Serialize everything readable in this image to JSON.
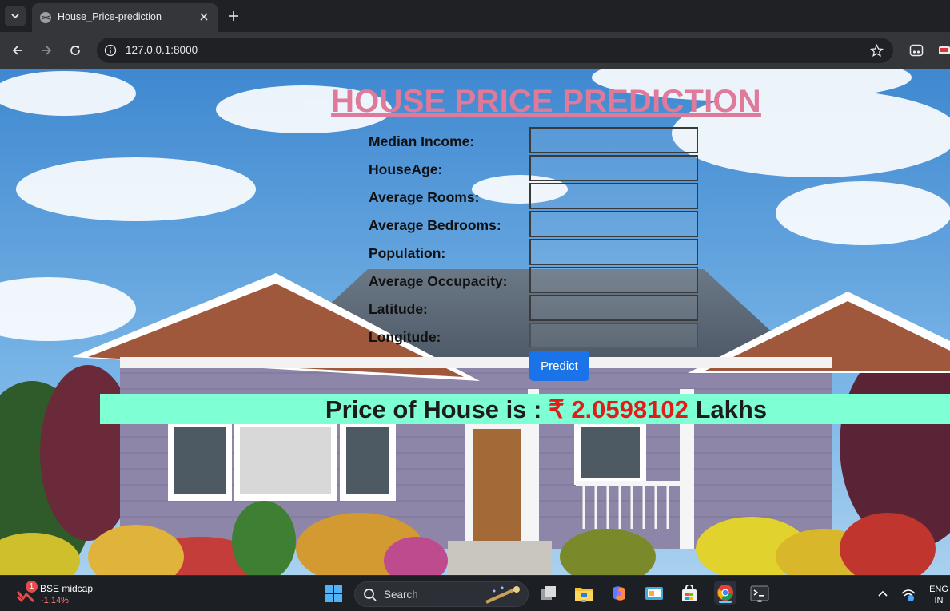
{
  "browser": {
    "tab_title": "House_Price-prediction",
    "url": "127.0.0.1:8000"
  },
  "page": {
    "heading": "HOUSE PRICE PREDICTION",
    "fields": [
      {
        "label": "Median Income:"
      },
      {
        "label": "HouseAge:"
      },
      {
        "label": "Average Rooms:"
      },
      {
        "label": "Average Bedrooms:"
      },
      {
        "label": "Population:"
      },
      {
        "label": "Average Occupacity:"
      },
      {
        "label": "Latitude:"
      },
      {
        "label": "Longitude:"
      }
    ],
    "predict_label": "Predict",
    "result_prefix": "Price of House is :",
    "result_value": "₹ 2.0598102",
    "result_suffix": "Lakhs"
  },
  "taskbar": {
    "widget_name": "BSE midcap",
    "widget_change": "-1.14%",
    "widget_badge": "1",
    "search_label": "Search",
    "lang_line1": "ENG",
    "lang_line2": "IN"
  },
  "colors": {
    "heading": "#e07a9b",
    "result_bar": "#7fffd4",
    "result_value": "#e21b1b",
    "predict_button": "#1a73e8"
  }
}
